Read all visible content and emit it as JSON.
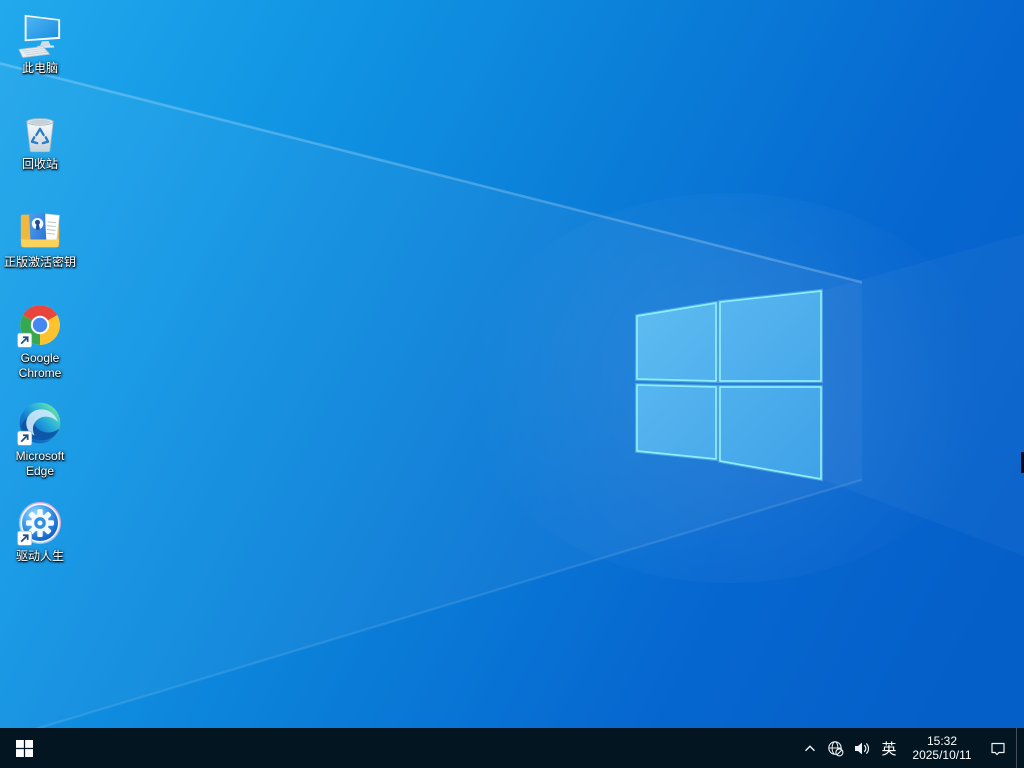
{
  "desktop": {
    "icons": [
      {
        "name": "this-pc",
        "label": "此电脑"
      },
      {
        "name": "recycle-bin",
        "label": "回收站"
      },
      {
        "name": "activation-key-folder",
        "label": "正版激活密钥"
      },
      {
        "name": "google-chrome",
        "label": "Google Chrome"
      },
      {
        "name": "microsoft-edge",
        "label": "Microsoft Edge"
      },
      {
        "name": "driver-life",
        "label": "驱动人生"
      }
    ]
  },
  "taskbar": {
    "start_icon": "windows-logo",
    "tray": {
      "hidden_icons_chevron": "chevron-up",
      "network_icon": "globe-no-internet",
      "volume_icon": "speaker",
      "ime_indicator": "英",
      "time": "15:32",
      "date": "2025/10/11",
      "action_center_icon": "notification-bubble"
    }
  },
  "colors": {
    "wallpaper_bright": "#22a9ec",
    "wallpaper_deep": "#055fc9",
    "logo_pane": "#4badea",
    "logo_edge": "#8deef9",
    "taskbar_bg": "#031520",
    "tray_foreground": "#ffffff"
  }
}
